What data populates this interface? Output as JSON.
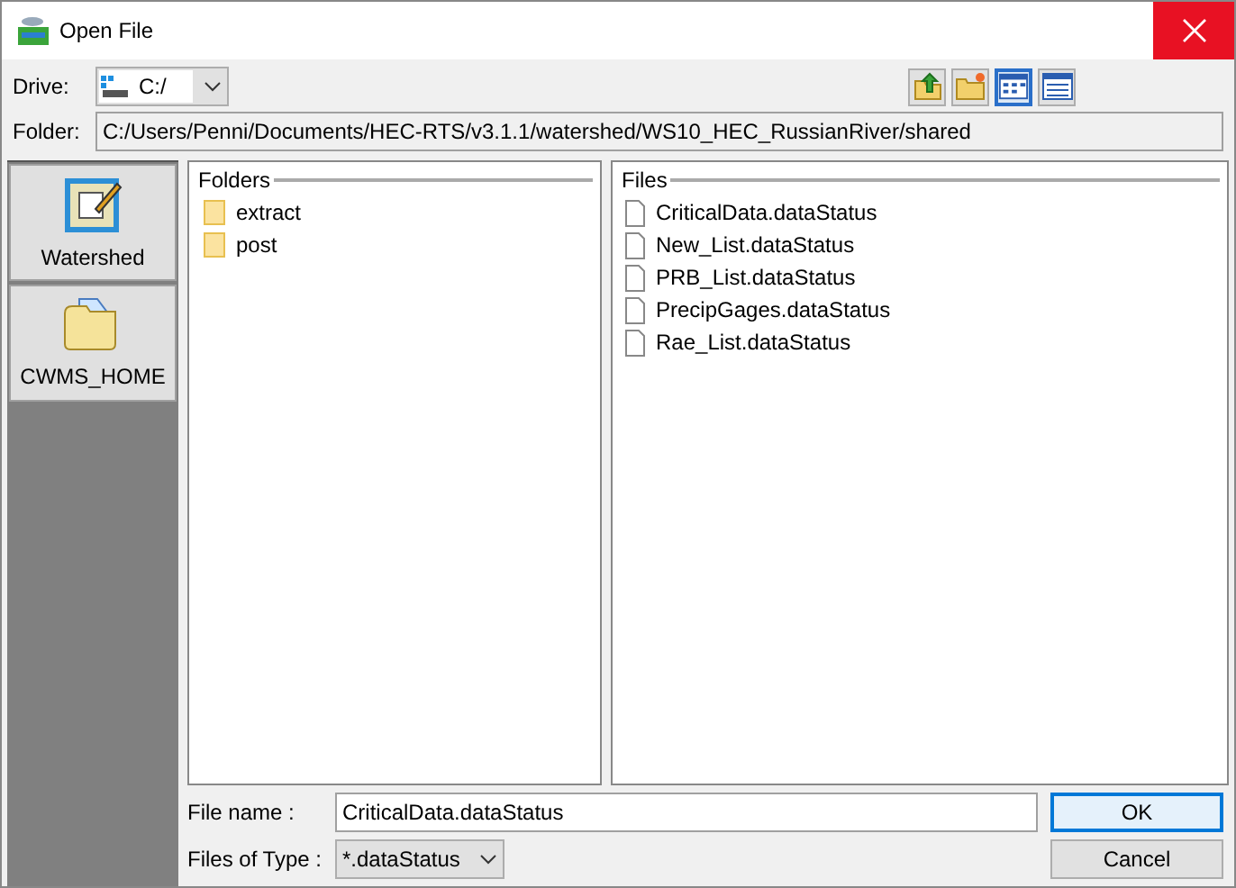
{
  "window": {
    "title": "Open File"
  },
  "drive": {
    "label": "Drive:",
    "value": "C:/"
  },
  "toolbar": [
    {
      "kind": "up",
      "selected": false
    },
    {
      "kind": "newfolder",
      "selected": false
    },
    {
      "kind": "list",
      "selected": true
    },
    {
      "kind": "details",
      "selected": false
    }
  ],
  "folder": {
    "label": "Folder:",
    "value": "C:/Users/Penni/Documents/HEC-RTS/v3.1.1/watershed/WS10_HEC_RussianRiver/shared"
  },
  "shortcuts": [
    {
      "kind": "watershed",
      "label": "Watershed"
    },
    {
      "kind": "folder",
      "label": "CWMS_HOME"
    }
  ],
  "folders": {
    "title": "Folders",
    "items": [
      "extract",
      "post"
    ]
  },
  "files": {
    "title": "Files",
    "items": [
      "CriticalData.dataStatus",
      "New_List.dataStatus",
      "PRB_List.dataStatus",
      "PrecipGages.dataStatus",
      "Rae_List.dataStatus"
    ]
  },
  "file_name": {
    "label": "File name :",
    "value": "CriticalData.dataStatus"
  },
  "file_type": {
    "label": "Files of Type :",
    "value": "*.dataStatus"
  },
  "buttons": [
    {
      "label": "OK",
      "selected": true
    },
    {
      "label": "Cancel",
      "selected": false
    }
  ]
}
